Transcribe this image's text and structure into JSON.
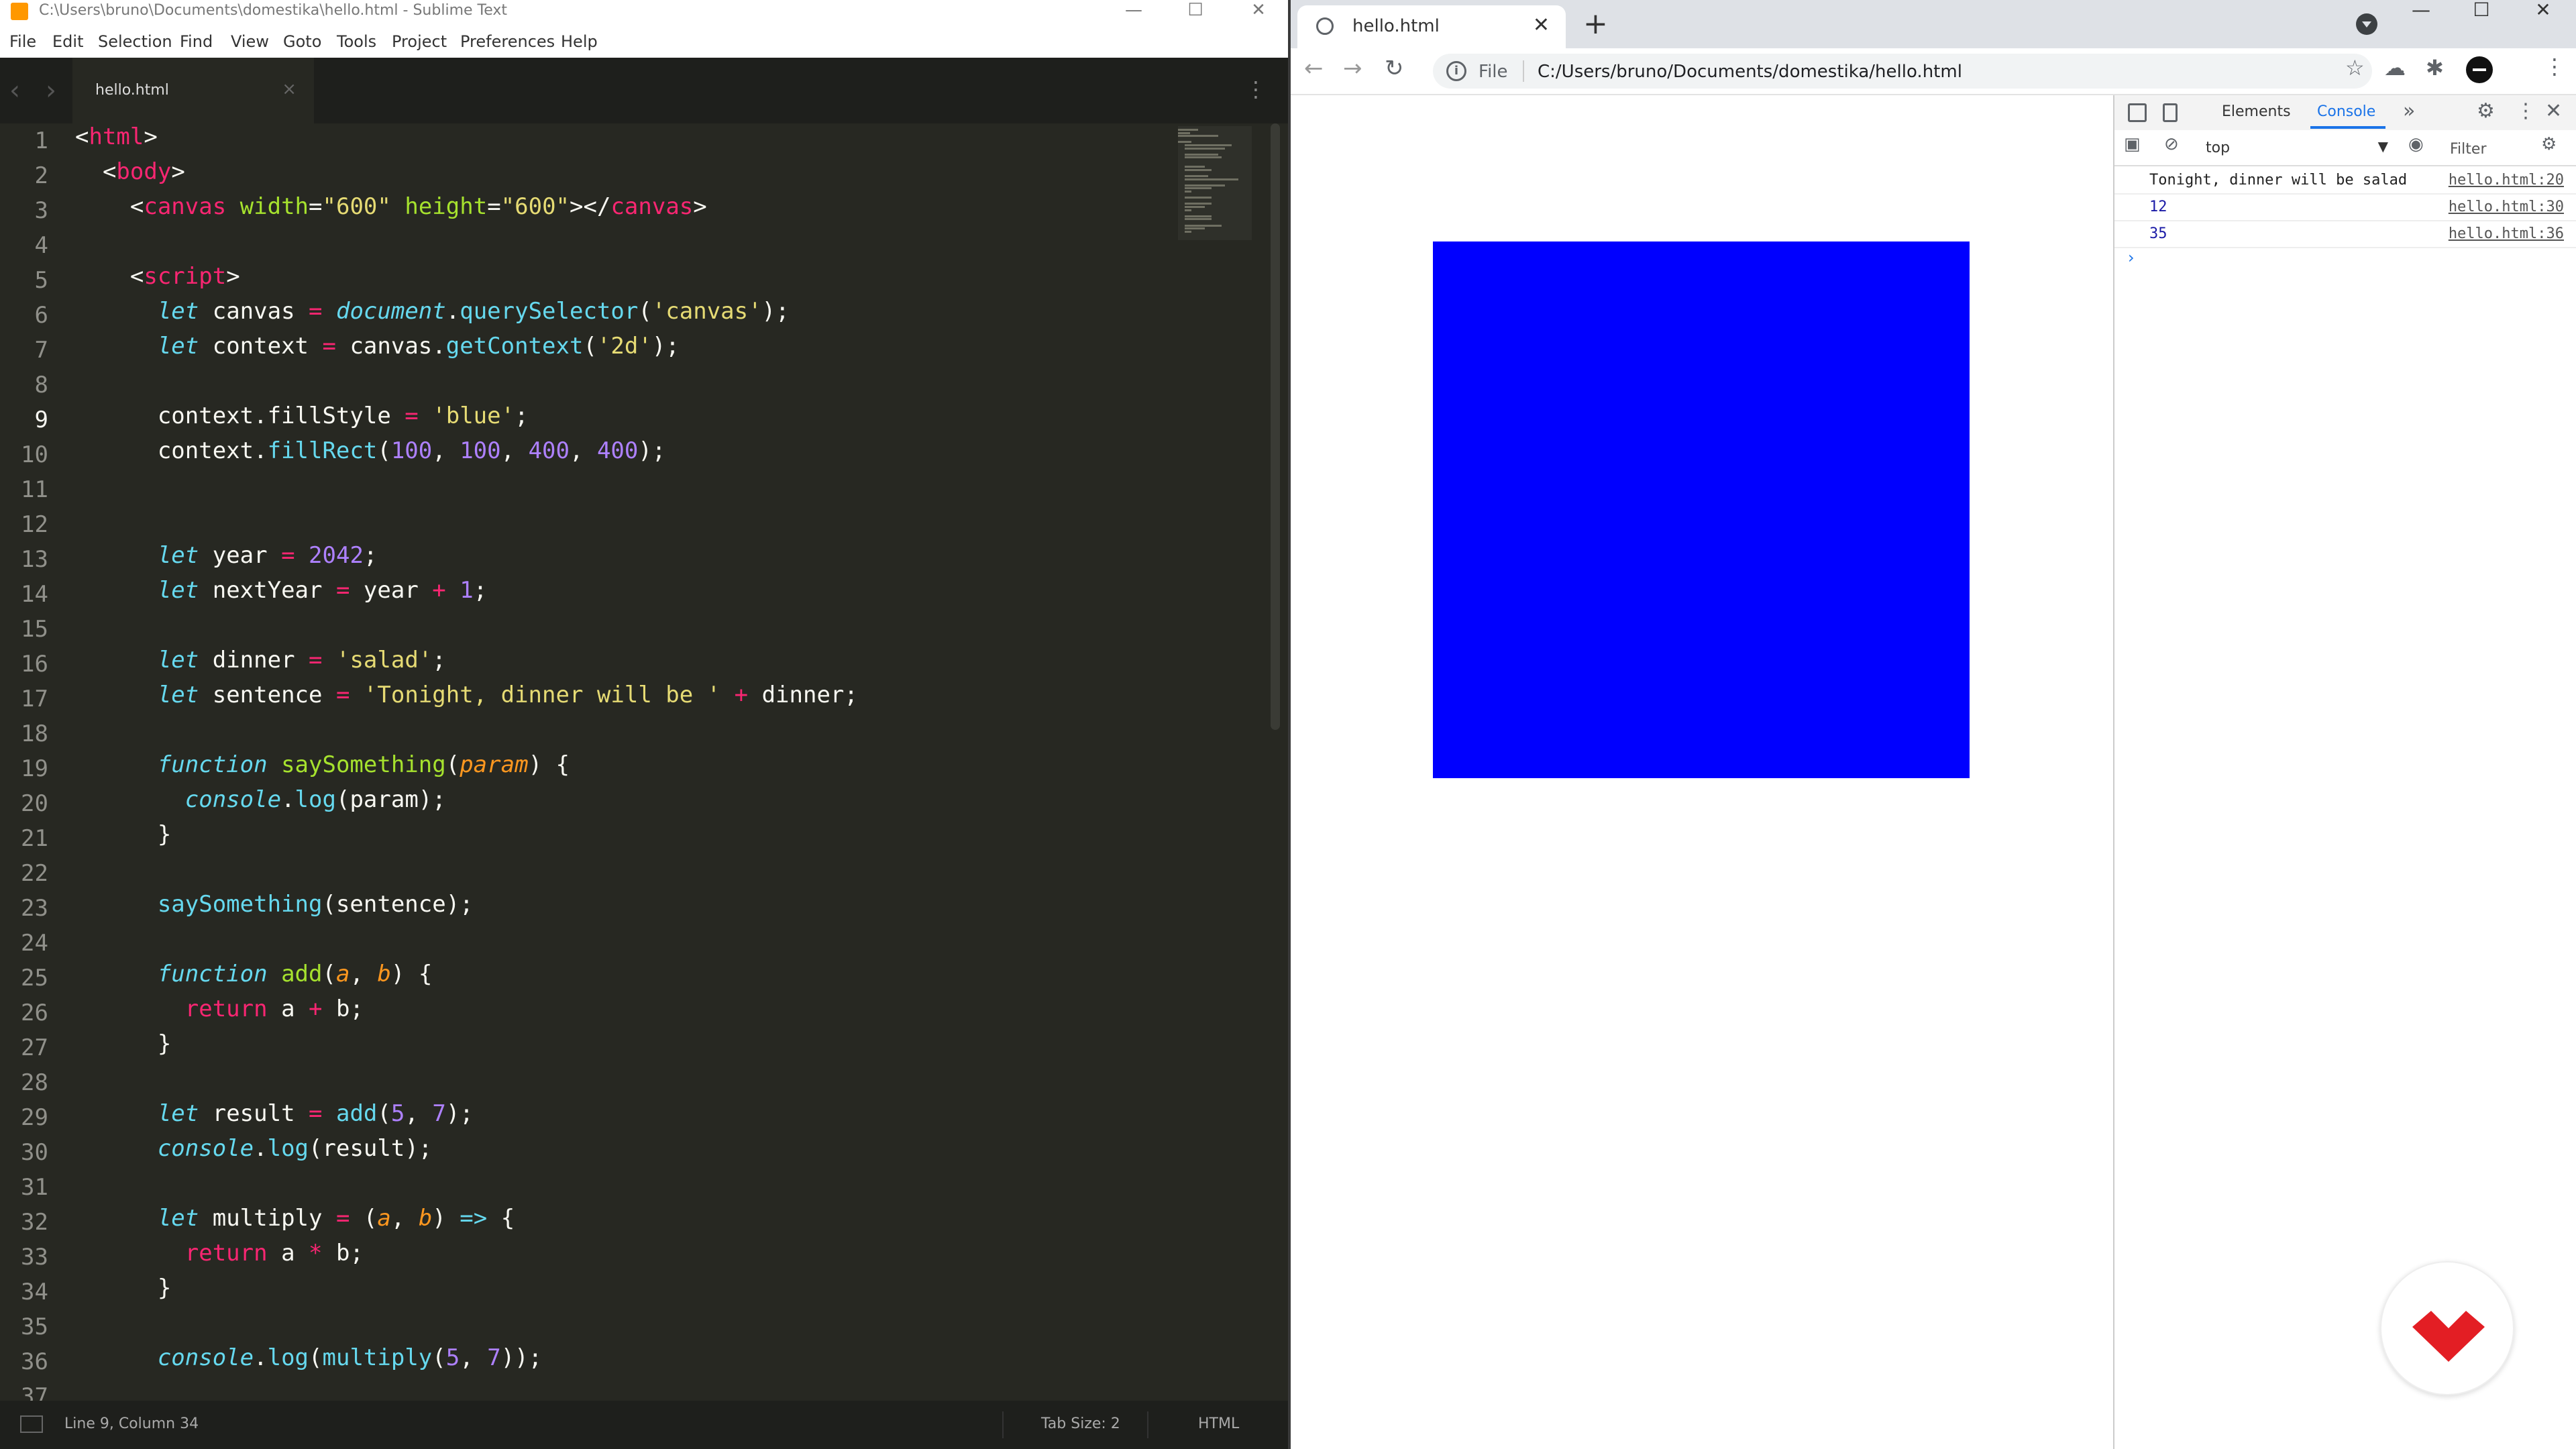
{
  "sublime": {
    "title": "C:\\Users\\bruno\\Documents\\domestika\\hello.html - Sublime Text",
    "menu": [
      "File",
      "Edit",
      "Selection",
      "Find",
      "View",
      "Goto",
      "Tools",
      "Project",
      "Preferences",
      "Help"
    ],
    "tab_label": "hello.html",
    "line_numbers": [
      "1",
      "2",
      "3",
      "4",
      "5",
      "6",
      "7",
      "8",
      "9",
      "10",
      "11",
      "12",
      "13",
      "14",
      "15",
      "16",
      "17",
      "18",
      "19",
      "20",
      "21",
      "22",
      "23",
      "24",
      "25",
      "26",
      "27",
      "28",
      "29",
      "30",
      "31",
      "32",
      "33",
      "34",
      "35",
      "36",
      "37"
    ],
    "current_line": 9,
    "status": {
      "position": "Line 9, Column 34",
      "tab_size": "Tab Size: 2",
      "syntax": "HTML"
    }
  },
  "chrome": {
    "tab_title": "hello.html",
    "address_scheme": "File",
    "address_url": "C:/Users/bruno/Documents/domestika/hello.html",
    "canvas_color": "#0000ff",
    "devtools": {
      "tabs": [
        "Elements",
        "Console"
      ],
      "active_tab": "Console",
      "context": "top",
      "filter_placeholder": "Filter",
      "console": [
        {
          "message": "Tonight, dinner will be salad",
          "source": "hello.html:20",
          "kind": "string"
        },
        {
          "message": "12",
          "source": "hello.html:30",
          "kind": "number"
        },
        {
          "message": "35",
          "source": "hello.html:36",
          "kind": "number"
        }
      ],
      "prompt": "›"
    }
  },
  "icons": {
    "logo": "domestika-logo-icon",
    "brand_color": "#e31e24"
  }
}
